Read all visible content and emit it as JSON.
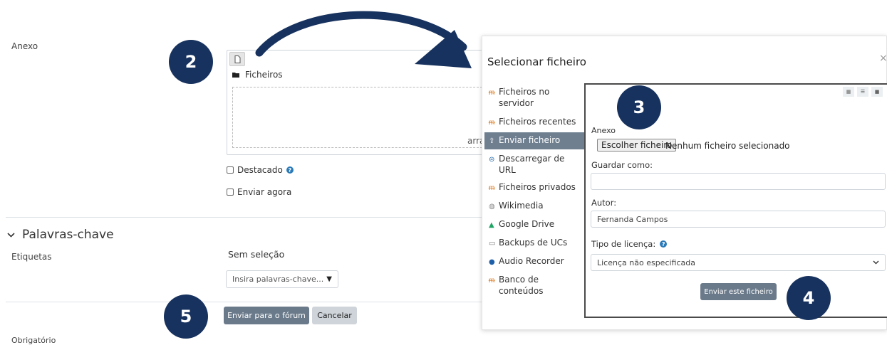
{
  "form": {
    "anexo_label": "Anexo",
    "file_path": "Ficheiros",
    "drop_text": "arra",
    "destacado_label": "Destacado",
    "enviar_agora_label": "Enviar agora",
    "section_title": "Palavras-chave",
    "etiquetas_label": "Etiquetas",
    "sem_selecao": "Sem seleção",
    "tags_placeholder": "Insira palavras-chave...",
    "submit_button": "Enviar para o fórum",
    "cancel_button": "Cancelar",
    "obrigatorio_label": "Obrigatório"
  },
  "steps": {
    "s2": "2",
    "s3": "3",
    "s4": "4",
    "s5": "5"
  },
  "dialog": {
    "title": "Selecionar ficheiro",
    "close": "×",
    "repositories": [
      {
        "label": "Ficheiros no servidor",
        "icon": "moodle-icon",
        "glyph": "ᵯ"
      },
      {
        "label": "Ficheiros recentes",
        "icon": "moodle-icon",
        "glyph": "ᵯ"
      },
      {
        "label": "Enviar ficheiro",
        "icon": "upload-icon",
        "glyph": "⇪"
      },
      {
        "label": "Descarregar de URL",
        "icon": "url-icon",
        "glyph": "⊜"
      },
      {
        "label": "Ficheiros privados",
        "icon": "moodle-icon",
        "glyph": "ᵯ"
      },
      {
        "label": "Wikimedia",
        "icon": "wikimedia-icon",
        "glyph": "◍"
      },
      {
        "label": "Google Drive",
        "icon": "google-drive-icon",
        "glyph": "▲"
      },
      {
        "label": "Backups de UCs",
        "icon": "backup-icon",
        "glyph": "▭"
      },
      {
        "label": "Audio Recorder",
        "icon": "microphone-icon",
        "glyph": "●"
      },
      {
        "label": "Banco de conteúdos",
        "icon": "moodle-icon",
        "glyph": "ᵯ"
      }
    ],
    "upload": {
      "anexo_label": "Anexo",
      "choose_button": "Escolher ficheiro",
      "no_file": "Nenhum ficheiro selecionado",
      "save_as_label": "Guardar como:",
      "save_as_value": "",
      "author_label": "Autor:",
      "author_value": "Fernanda Campos",
      "license_label": "Tipo de licença:",
      "license_value": "Licença não especificada",
      "submit_button": "Enviar este ficheiro"
    }
  },
  "colors": {
    "badge": "#17325e",
    "primary_button": "#6a7a8a",
    "active_repo": "#6f7f90",
    "help_icon": "#2b7bb9"
  }
}
